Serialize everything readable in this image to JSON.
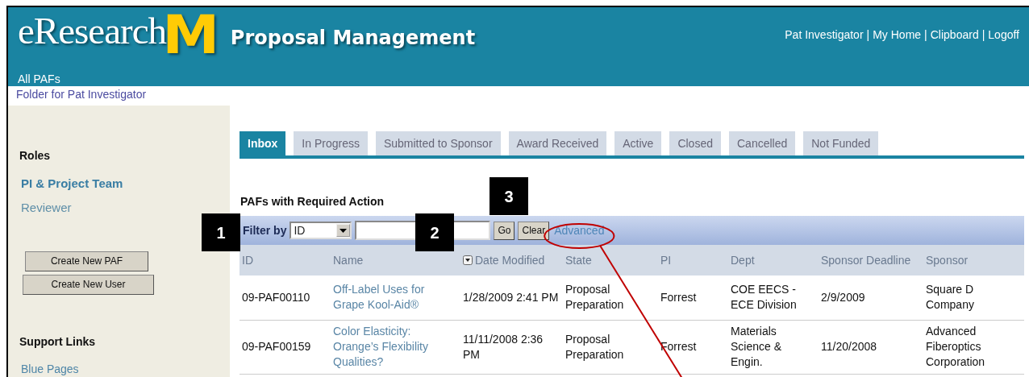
{
  "header": {
    "logo_text": "eResearch",
    "logo_mark": "M",
    "title": "Proposal Management",
    "user_links": [
      "Pat Investigator",
      "My Home",
      "Clipboard",
      "Logoff"
    ],
    "user_link_separator": "|",
    "nav_link": "All PAFs"
  },
  "breadcrumb": "Folder for  Pat Investigator",
  "sidebar": {
    "roles_heading": "Roles",
    "roles": [
      {
        "label": "PI & Project Team",
        "selected": true
      },
      {
        "label": "Reviewer",
        "selected": false
      }
    ],
    "buttons": [
      "Create New PAF",
      "Create New User"
    ],
    "support_heading": "Support Links",
    "support_links": [
      "Blue Pages"
    ]
  },
  "tabs": [
    {
      "label": "Inbox",
      "selected": true
    },
    {
      "label": "In Progress",
      "selected": false
    },
    {
      "label": "Submitted to Sponsor",
      "selected": false
    },
    {
      "label": "Award Received",
      "selected": false
    },
    {
      "label": "Active",
      "selected": false
    },
    {
      "label": "Closed",
      "selected": false
    },
    {
      "label": "Cancelled",
      "selected": false
    },
    {
      "label": "Not Funded",
      "selected": false
    }
  ],
  "section_title": "PAFs with Required Action",
  "filter": {
    "label": "Filter by",
    "select_value": "ID",
    "buttons": [
      "Go",
      "Clear"
    ],
    "advanced_link": "Advanced"
  },
  "table": {
    "columns": [
      {
        "label": "ID",
        "sorted": false
      },
      {
        "label": "Name",
        "sorted": false
      },
      {
        "label": "Date Modified",
        "sorted": true
      },
      {
        "label": "State",
        "sorted": false
      },
      {
        "label": "PI",
        "sorted": false
      },
      {
        "label": "Dept",
        "sorted": false
      },
      {
        "label": "Sponsor Deadline",
        "sorted": false
      },
      {
        "label": "Sponsor",
        "sorted": false
      }
    ],
    "rows": [
      {
        "cells": [
          "09-PAF00110",
          "Off-Label Uses for Grape Kool-Aid®",
          "1/28/2009 2:41 PM",
          "Proposal Preparation",
          "Forrest",
          "COE EECS - ECE Division",
          "2/9/2009",
          "Square D Company"
        ]
      },
      {
        "cells": [
          "09-PAF00159",
          "Color Elasticity: Orange’s Flexibility Qualities?",
          "11/11/2008 2:36 PM",
          "Proposal Preparation",
          "Forrest",
          "Materials Science & Engin.",
          "11/20/2008",
          "Advanced Fiberoptics Corporation"
        ]
      }
    ]
  },
  "callouts": [
    "1",
    "2",
    "3"
  ]
}
